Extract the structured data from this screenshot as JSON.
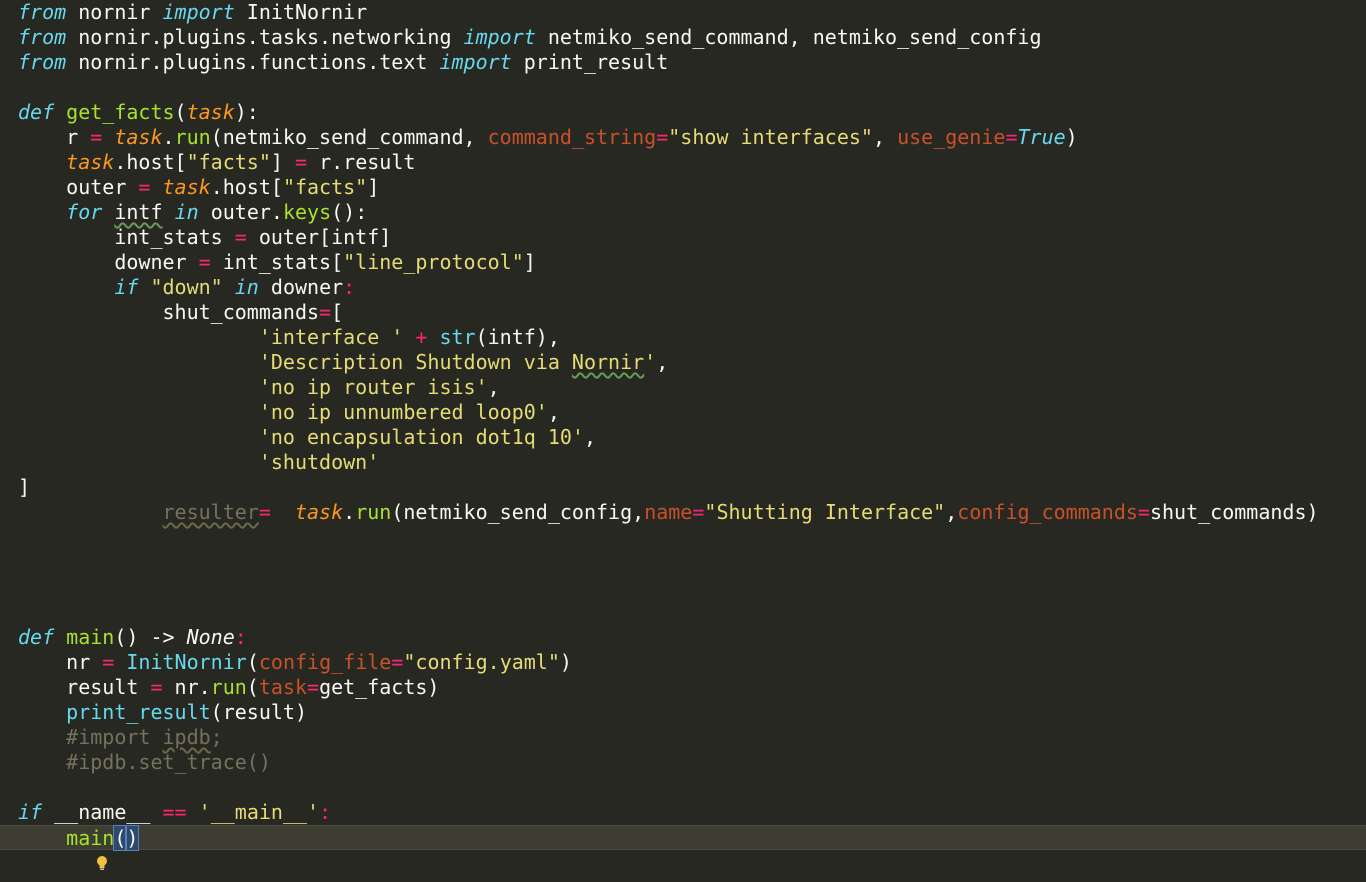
{
  "editor": {
    "theme_colors": {
      "background": "#272822",
      "keyword": "#66d9ef",
      "function": "#a6e22e",
      "string": "#e6db74",
      "operator": "#f92672",
      "parameter": "#fd971f",
      "comment": "#75715e"
    },
    "lines": {
      "l1": {
        "a": "from",
        "b": " nornir ",
        "c": "import",
        "d": " InitNornir"
      },
      "l2": {
        "a": "from",
        "b": " nornir.plugins.tasks.networking ",
        "c": "import",
        "d": " netmiko_send_command, netmiko_send_config"
      },
      "l3": {
        "a": "from",
        "b": " nornir.plugins.functions.text ",
        "c": "import",
        "d": " print_result"
      },
      "l5": {
        "a": "def",
        "b": " ",
        "c": "get_facts",
        "d": "(",
        "e": "task",
        "f": "):"
      },
      "l6": {
        "a": "    r ",
        "b": "=",
        "c": " ",
        "d": "task",
        "e": ".",
        "f": "run",
        "g": "(netmiko_send_command, ",
        "h": "command_string",
        "i": "=",
        "j": "\"show interfaces\"",
        "k": ", ",
        "l": "use_genie",
        "m": "=",
        "n": "True",
        "o": ")"
      },
      "l7": {
        "a": "    ",
        "b": "task",
        "c": ".host[",
        "d": "\"facts\"",
        "e": "] ",
        "f": "=",
        "g": " r.result"
      },
      "l8": {
        "a": "    outer ",
        "b": "=",
        "c": " ",
        "d": "task",
        "e": ".host[",
        "f": "\"facts\"",
        "g": "]"
      },
      "l9": {
        "a": "    ",
        "b": "for",
        "c": " ",
        "d": "intf",
        "e": " ",
        "f": "in",
        "g": " outer.",
        "h": "keys",
        "i": "():"
      },
      "l10": {
        "a": "        int_stats ",
        "b": "=",
        "c": " outer[intf]"
      },
      "l11": {
        "a": "        downer ",
        "b": "=",
        "c": " int_stats[",
        "d": "\"line_protocol\"",
        "e": "]"
      },
      "l12": {
        "a": "        ",
        "b": "if",
        "c": " ",
        "d": "\"down\"",
        "e": " ",
        "f": "in",
        "g": " downer",
        "h": ":"
      },
      "l13": {
        "a": "            shut_commands",
        "b": "=",
        "c": "["
      },
      "l14": {
        "a": "                    ",
        "b": "'interface '",
        "c": " ",
        "d": "+",
        "e": " ",
        "f": "str",
        "g": "(intf),"
      },
      "l15": {
        "a": "                    ",
        "b": "'Description Shutdown via ",
        "c": "Nornir",
        "d": "'",
        "e": ","
      },
      "l16": {
        "a": "                    ",
        "b": "'no ip router isis'",
        "c": ","
      },
      "l17": {
        "a": "                    ",
        "b": "'no ip unnumbered loop0'",
        "c": ","
      },
      "l18": {
        "a": "                    ",
        "b": "'no encapsulation dot1q 10'",
        "c": ","
      },
      "l19": {
        "a": "                    ",
        "b": "'shutdown'"
      },
      "l20": {
        "a": "]"
      },
      "l21": {
        "a": "            ",
        "b": "resulter",
        "c": "=",
        "d": "  ",
        "e": "task",
        "f": ".",
        "g": "run",
        "h": "(netmiko_send_config,",
        "i": "name",
        "j": "=",
        "k": "\"Shutting Interface\"",
        "l": ",",
        "m": "config_commands",
        "n": "=",
        "o": "shut_commands)"
      },
      "l26": {
        "a": "def",
        "b": " ",
        "c": "main",
        "d": "() -> ",
        "e": "None",
        "f": ":"
      },
      "l27": {
        "a": "    nr ",
        "b": "=",
        "c": " ",
        "d": "InitNornir",
        "e": "(",
        "f": "config_file",
        "g": "=",
        "h": "\"config.yaml\"",
        "i": ")"
      },
      "l28": {
        "a": "    result ",
        "b": "=",
        "c": " nr.",
        "d": "run",
        "e": "(",
        "f": "task",
        "g": "=",
        "h": "get_facts)"
      },
      "l29": {
        "a": "    ",
        "b": "print_result",
        "c": "(result)"
      },
      "l30": {
        "a": "    #import ",
        "b": "ipdb",
        "c": ";"
      },
      "l31": {
        "a": "    #ipdb.set_trace()"
      },
      "l33": {
        "a": "if",
        "b": " __name__ ",
        "c": "==",
        "d": " ",
        "e": "'__main__'",
        "f": ":"
      },
      "l34": {
        "a": "    ",
        "b": "main",
        "c": "(",
        "d": ")"
      }
    }
  }
}
